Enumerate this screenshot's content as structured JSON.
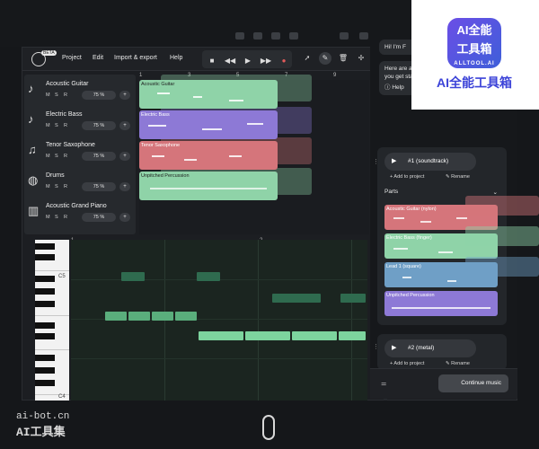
{
  "menu": {
    "beta": "BETA",
    "items": [
      "Project",
      "Edit",
      "Import & export",
      "Help"
    ]
  },
  "tracks": [
    {
      "name": "Acoustic Guitar",
      "icon": "guitar-icon",
      "m": "M",
      "s": "S",
      "r": "R",
      "volume": "75 %"
    },
    {
      "name": "Electric Bass",
      "icon": "bass-icon",
      "m": "M",
      "s": "S",
      "r": "R",
      "volume": "75 %"
    },
    {
      "name": "Tenor Saxophone",
      "icon": "saxophone-icon",
      "m": "M",
      "s": "S",
      "r": "R",
      "volume": "75 %"
    },
    {
      "name": "Drums",
      "icon": "drums-icon",
      "m": "M",
      "s": "S",
      "r": "R",
      "volume": "75 %"
    },
    {
      "name": "Acoustic Grand Piano",
      "icon": "piano-icon",
      "m": "M",
      "s": "S",
      "r": "R",
      "volume": "75 %"
    }
  ],
  "arrangement": {
    "ruler": [
      "1",
      "3",
      "5",
      "7",
      "9"
    ],
    "clips": [
      {
        "label": "Acoustic Guitar",
        "color": "#8fd3a8"
      },
      {
        "label": "Electric Bass",
        "color": "#8d79d6"
      },
      {
        "label": "Tenor Saxophone",
        "color": "#d5757b"
      },
      {
        "label": "Unpitched Percussion",
        "color": "#8fd3a8"
      }
    ]
  },
  "piano_roll": {
    "ruler": [
      "1",
      "2"
    ],
    "labels": {
      "c5": "C5",
      "c4": "C4"
    }
  },
  "chat": {
    "greeting": "Hi! I'm F",
    "intro": "Here are a few snippets of music to help you get started.",
    "help": "Help",
    "snippets": [
      {
        "title": "#1 (soundtrack)",
        "add": "+ Add to project",
        "rename": "✎ Rename",
        "parts_label": "Parts"
      },
      {
        "title": "#2 (metal)",
        "add": "+ Add to project",
        "rename": "✎ Rename"
      }
    ],
    "parts": [
      {
        "label": "Acoustic Guitar (nylon)",
        "color": "#d5757b"
      },
      {
        "label": "Electric Bass (finger)",
        "color": "#8fd3a8"
      },
      {
        "label": "Lead 1 (square)",
        "color": "#6f9fc6"
      },
      {
        "label": "Unpitched Percussion",
        "color": "#8d79d6"
      }
    ],
    "continue": "Continue music"
  },
  "watermark": {
    "logo_line1": "AI全能",
    "logo_line2": "工具箱",
    "logo_sub": "ALLTOOL.AI",
    "caption": "AI全能工具箱",
    "site": "ai-bot.cn",
    "site_name": "AI工具集"
  }
}
